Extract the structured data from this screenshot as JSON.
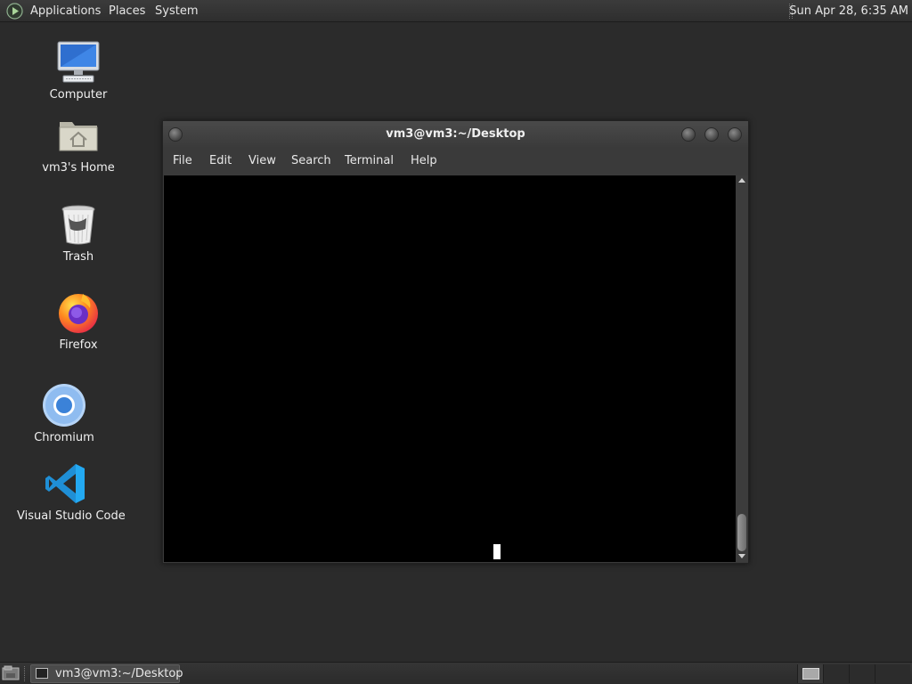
{
  "top_panel": {
    "menus": {
      "applications": "Applications",
      "places": "Places",
      "system": "System"
    },
    "clock": "Sun Apr 28,  6:35 AM"
  },
  "desktop": {
    "icons": [
      {
        "label": "Computer",
        "icon": "computer-icon"
      },
      {
        "label": "vm3's Home",
        "icon": "home-folder-icon"
      },
      {
        "label": "Trash",
        "icon": "trash-icon"
      },
      {
        "label": "Firefox",
        "icon": "firefox-icon"
      },
      {
        "label": "Chromium",
        "icon": "chromium-icon"
      },
      {
        "label": "Visual Studio Code",
        "icon": "vscode-icon"
      }
    ]
  },
  "terminal_window": {
    "title": "vm3@vm3:~/Desktop",
    "menu": {
      "file": "File",
      "edit": "Edit",
      "view": "View",
      "search": "Search",
      "terminal": "Terminal",
      "help": "Help"
    }
  },
  "bottom_panel": {
    "tasks": [
      {
        "label": "vm3@vm3:~/Desktop",
        "icon": "terminal-icon"
      }
    ],
    "workspaces_count": 4,
    "active_workspace": 1
  },
  "colors": {
    "desktop_bg": "#2b2b2b",
    "terminal_bg": "#000000",
    "panel_bg": "#333333",
    "vscode_blue": "#23a9f2",
    "chromium_blue": "#3b82d8"
  }
}
